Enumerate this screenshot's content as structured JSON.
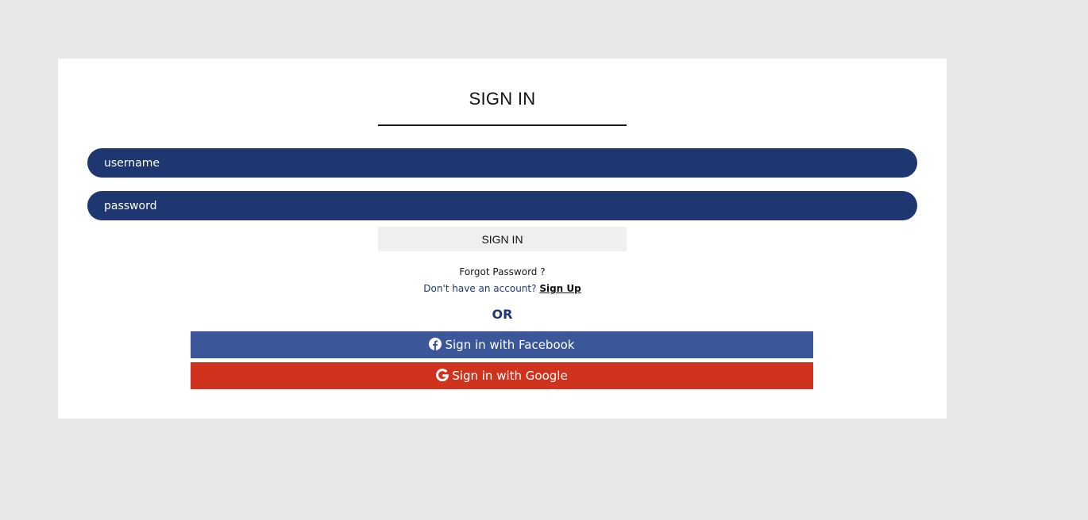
{
  "signin_form": {
    "title": "SIGN IN",
    "username_placeholder": "username",
    "password_placeholder": "password",
    "submit_label": "SIGN IN",
    "forgot_password": "Forgot Password ?",
    "no_account_text": "Don't have an account?",
    "signup_link": "Sign Up",
    "or_divider": "OR",
    "facebook_label": "Sign in with Facebook",
    "google_label": "Sign in with Google"
  },
  "icons": {
    "facebook": "facebook-icon",
    "google": "google-icon"
  },
  "colors": {
    "page_background": "#e8e8e8",
    "card_background": "#ffffff",
    "field_background": "#1e3770",
    "facebook": "#3b5699",
    "google": "#cf331e",
    "signin_button": "#efefef"
  }
}
